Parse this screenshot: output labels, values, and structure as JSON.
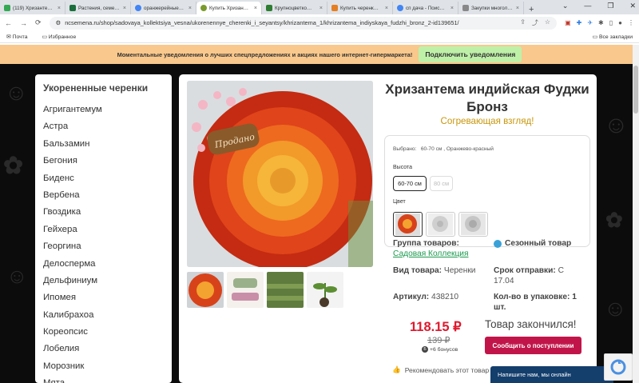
{
  "browser": {
    "tabs": [
      {
        "label": "(119) Хризанте…",
        "color": "#34a853"
      },
      {
        "label": "Растения, семе…",
        "color": "#1a6e3a"
      },
      {
        "label": "оранжерейные…",
        "color": "#4285f4"
      },
      {
        "label": "Купить Хризан…",
        "color": "#7a9a2b",
        "active": true
      },
      {
        "label": "Крупноцветко…",
        "color": "#2e7d32"
      },
      {
        "label": "Купить черенк…",
        "color": "#e67e22"
      },
      {
        "label": "сп дача - Поис…",
        "color": "#4285f4"
      },
      {
        "label": "Закупки многол…",
        "color": "#888888"
      }
    ],
    "new_tab": "+",
    "url": "ncsemena.ru/shop/sadovaya_kollektsiya_vesna/ukorenennye_cherenki_i_seyantsy/khrizantema_1/khrizantema_indiyskaya_fudzhi_bronz_2-id139651/",
    "bookmarks": [
      "Почта",
      "Избранное"
    ],
    "all_bookmarks": "Все закладки"
  },
  "notification": {
    "text": "Моментальные уведомления о лучших спецпредложениях и акциях нашего интернет-гипермаркета!",
    "button": "Подключить уведомления"
  },
  "sidebar": {
    "title": "Укорененные черенки",
    "items": [
      "Агригантемум",
      "Астра",
      "Бальзамин",
      "Бегония",
      "Биденс",
      "Вербена",
      "Гвоздика",
      "Гейхера",
      "Георгина",
      "Делосперма",
      "Дельфиниум",
      "Ипомея",
      "Калибрахоа",
      "Кореопсис",
      "Лобелия",
      "Морозник",
      "Мята"
    ]
  },
  "product": {
    "title": "Хризантема индийская Фуджи Бронз",
    "subtitle": "Согревающая взгляд!",
    "sold_tag": "Продано",
    "selected_label": "Выбрано:",
    "selected_value": "60-70 см , Оранжево-красный",
    "height_label": "Высота",
    "height_options": [
      "60-70 см",
      "80 см"
    ],
    "color_label": "Цвет",
    "group_label": "Группа товаров:",
    "group_link": "Садовая Коллекция",
    "season": "Сезонный товар",
    "type_label": "Вид товара:",
    "type_value": "Черенки",
    "ship_label": "Срок отправки:",
    "ship_value": "С 17.04",
    "sku_label": "Артикул:",
    "sku_value": "438210",
    "pack_label": "Кол-во в упаковке:",
    "pack_value": "1 шт.",
    "price": "118.15 ₽",
    "old_price": "139 ₽",
    "bonus": "+6 бонусов",
    "out_of_stock": "Товар закончился!",
    "notify_button": "Сообщить о поступлении",
    "recommend": "Рекомендовать этот товар"
  },
  "chat": "Напишите нам, мы онлайн"
}
